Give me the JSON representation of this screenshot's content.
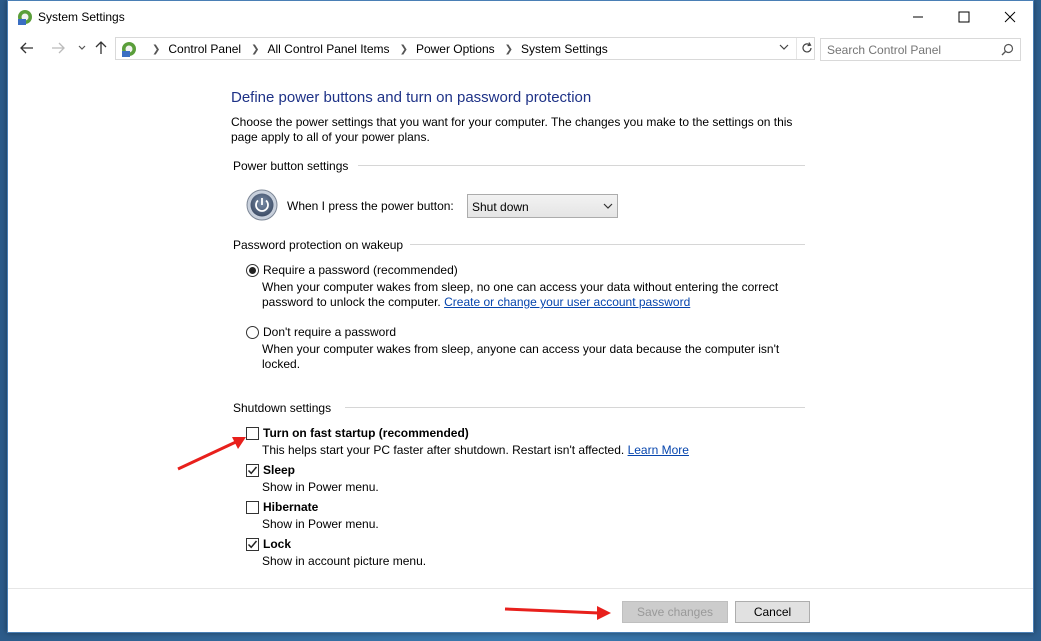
{
  "window": {
    "title": "System Settings"
  },
  "nav": {
    "breadcrumbs": [
      "Control Panel",
      "All Control Panel Items",
      "Power Options",
      "System Settings"
    ],
    "search_placeholder": "Search Control Panel"
  },
  "main": {
    "heading": "Define power buttons and turn on password protection",
    "intro": "Choose the power settings that you want for your computer. The changes you make to the settings on this page apply to all of your power plans.",
    "power_section": {
      "title": "Power button settings",
      "label": "When I press the power button:",
      "selected_option": "Shut down"
    },
    "password_section": {
      "title": "Password protection on wakeup",
      "require": {
        "label": "Require a password (recommended)",
        "desc_line1": "When your computer wakes from sleep, no one can access your data without entering the correct",
        "desc_line2": "password to unlock the computer.",
        "link": "Create or change your user account password",
        "selected": true
      },
      "dont_require": {
        "label": "Don't require a password",
        "desc_line1": "When your computer wakes from sleep, anyone can access your data because the computer isn't",
        "desc_line2": "locked.",
        "selected": false
      }
    },
    "shutdown_section": {
      "title": "Shutdown settings",
      "items": [
        {
          "label": "Turn on fast startup (recommended)",
          "desc": "This helps start your PC faster after shutdown. Restart isn't affected.",
          "link": "Learn More",
          "checked": false
        },
        {
          "label": "Sleep",
          "desc": "Show in Power menu.",
          "checked": true
        },
        {
          "label": "Hibernate",
          "desc": "Show in Power menu.",
          "checked": false
        },
        {
          "label": "Lock",
          "desc": "Show in account picture menu.",
          "checked": true
        }
      ]
    }
  },
  "footer": {
    "save_label": "Save changes",
    "cancel_label": "Cancel"
  },
  "colors": {
    "heading": "#1e3287",
    "link": "#0645ad",
    "annotation_arrow": "#e8201c"
  }
}
